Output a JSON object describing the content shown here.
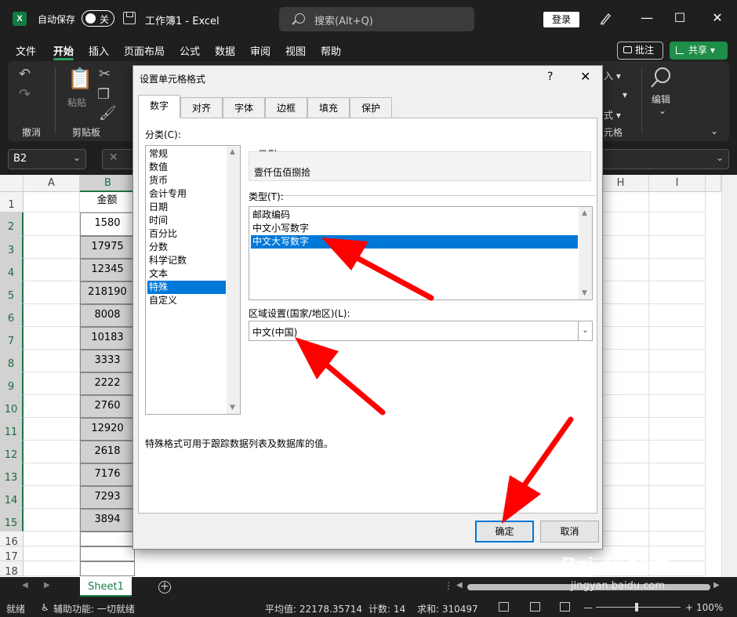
{
  "titlebar": {
    "app_icon": "X",
    "autosave_label": "自动保存",
    "autosave_state": "关",
    "doc_title": "工作簿1  -  Excel",
    "search_placeholder": "搜索(Alt+Q)",
    "login": "登录",
    "minimize": "—",
    "maximize": "☐",
    "close": "✕"
  },
  "menu": {
    "items": [
      "文件",
      "开始",
      "插入",
      "页面布局",
      "公式",
      "数据",
      "审阅",
      "视图",
      "帮助"
    ],
    "active": "开始",
    "comment": "批注",
    "share": "共享 ▾"
  },
  "ribbon": {
    "groups": [
      "撤消",
      "剪贴板",
      "编辑"
    ],
    "paste": "粘贴",
    "partial_labels": [
      "入 ▾",
      "▾",
      "式 ▾",
      "元格"
    ]
  },
  "formula_bar": {
    "name_box": "B2"
  },
  "grid": {
    "columns": [
      "A",
      "B",
      "H",
      "I"
    ],
    "rows": [
      "1",
      "2",
      "3",
      "4",
      "5",
      "6",
      "7",
      "8",
      "9",
      "10",
      "11",
      "12",
      "13",
      "14",
      "15",
      "16",
      "17",
      "18"
    ],
    "b_header": "金额",
    "b_values": [
      "1580",
      "17975",
      "12345",
      "218190",
      "8008",
      "10183",
      "3333",
      "2222",
      "2760",
      "12920",
      "2618",
      "7176",
      "7293",
      "3894"
    ]
  },
  "sheets": {
    "active": "Sheet1",
    "add": "+"
  },
  "status": {
    "ready": "就绪",
    "accessibility": "辅助功能: 一切就绪",
    "average": "平均值: 22178.35714",
    "count": "计数: 14",
    "sum": "求和: 310497",
    "zoom_minus": "—",
    "zoom_plus": "+",
    "zoom": "100%"
  },
  "dialog": {
    "title": "设置单元格格式",
    "help": "?",
    "close": "✕",
    "tabs": [
      "数字",
      "对齐",
      "字体",
      "边框",
      "填充",
      "保护"
    ],
    "category_label": "分类(C):",
    "categories": [
      "常规",
      "数值",
      "货币",
      "会计专用",
      "日期",
      "时间",
      "百分比",
      "分数",
      "科学记数",
      "文本",
      "特殊",
      "自定义"
    ],
    "selected_category": "特殊",
    "sample_label": "示例",
    "sample_value": "壹仟伍佰捌拾",
    "type_label": "类型(T):",
    "types": [
      "邮政编码",
      "中文小写数字",
      "中文大写数字"
    ],
    "selected_type": "中文大写数字",
    "locale_label": "区域设置(国家/地区)(L):",
    "locale_value": "中文(中国)",
    "description": "特殊格式可用于跟踪数据列表及数据库的值。",
    "ok": "确定",
    "cancel": "取消"
  },
  "watermark": {
    "logo": "Bai du 经验",
    "url": "jingyan.baidu.com"
  },
  "colors": {
    "excel_green": "#217346",
    "selection_blue": "#0078d7",
    "arrow_red": "#ff0000"
  }
}
